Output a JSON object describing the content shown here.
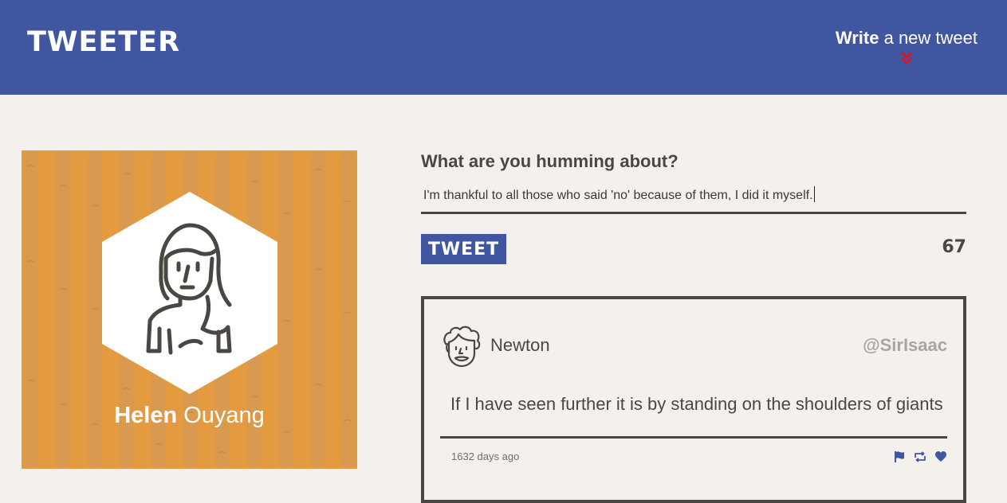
{
  "header": {
    "brand": "TWEETER",
    "compose_toggle": {
      "bold": "Write",
      "light": "a new tweet"
    },
    "toggle_icon": "double-chevron-down-icon"
  },
  "profile": {
    "first_name": "Helen",
    "last_name": "Ouyang",
    "avatar_icon": "woman-avatar-icon",
    "background_color": "#e49a3e"
  },
  "compose": {
    "label": "What are you humming about?",
    "input_value": "I'm thankful to all those who said 'no' because of them, I did it myself.",
    "submit_label": "TWEET",
    "char_counter": "67"
  },
  "tweets": [
    {
      "author_name": "Newton",
      "handle": "@SirIsaac",
      "avatar_icon": "curly-hair-man-avatar-icon",
      "content": "If I have seen further it is by standing on the shoulders of giants",
      "timestamp": "1632 days ago",
      "actions": [
        "flag-icon",
        "retweet-icon",
        "heart-icon"
      ]
    }
  ],
  "colors": {
    "primary": "#4056a1",
    "accent": "#d11c25",
    "background": "#f4f1ec",
    "text": "#4a4742",
    "muted": "#a8a6a2"
  }
}
